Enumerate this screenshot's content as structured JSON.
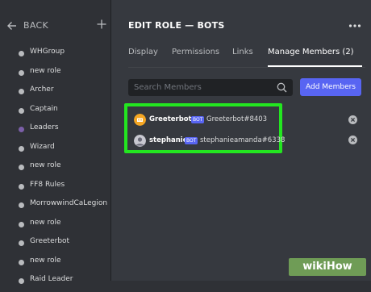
{
  "sidebar": {
    "back_label": "BACK",
    "roles": [
      {
        "name": "WHGroup",
        "color": "#b9bbbe"
      },
      {
        "name": "new role",
        "color": "#b9bbbe"
      },
      {
        "name": "Archer",
        "color": "#b9bbbe"
      },
      {
        "name": "Captain",
        "color": "#b9bbbe"
      },
      {
        "name": "Leaders",
        "color": "#7b5fa8"
      },
      {
        "name": "Wizard",
        "color": "#b9bbbe"
      },
      {
        "name": "new role",
        "color": "#b9bbbe"
      },
      {
        "name": "FF8 Rules",
        "color": "#b9bbbe"
      },
      {
        "name": "MorrowwindCaLegion",
        "color": "#b9bbbe"
      },
      {
        "name": "new role",
        "color": "#b9bbbe"
      },
      {
        "name": "Greeterbot",
        "color": "#b9bbbe"
      },
      {
        "name": "new role",
        "color": "#b9bbbe"
      },
      {
        "name": "Raid Leader",
        "color": "#b9bbbe"
      }
    ]
  },
  "header": {
    "title": "EDIT ROLE — BOTS",
    "more_icon": "more-horizontal-icon"
  },
  "tabs": [
    {
      "label": "Display",
      "active": false
    },
    {
      "label": "Permissions",
      "active": false
    },
    {
      "label": "Links",
      "active": false
    },
    {
      "label": "Manage Members (2)",
      "active": true
    }
  ],
  "search": {
    "placeholder": "Search Members",
    "value": ""
  },
  "add_members_label": "Add Members",
  "members": [
    {
      "name": "Greeterbot",
      "badge": "BOT",
      "tag": "Greeterbot#8403",
      "avatar_color": "#f5a623"
    },
    {
      "name": "stephanie",
      "badge": "BOT",
      "tag": "stephanieamanda#6338",
      "avatar_color": "#c8c8d0"
    }
  ],
  "highlight_color": "#23e620",
  "accent_color": "#5865f2",
  "watermark": "wikiHow"
}
